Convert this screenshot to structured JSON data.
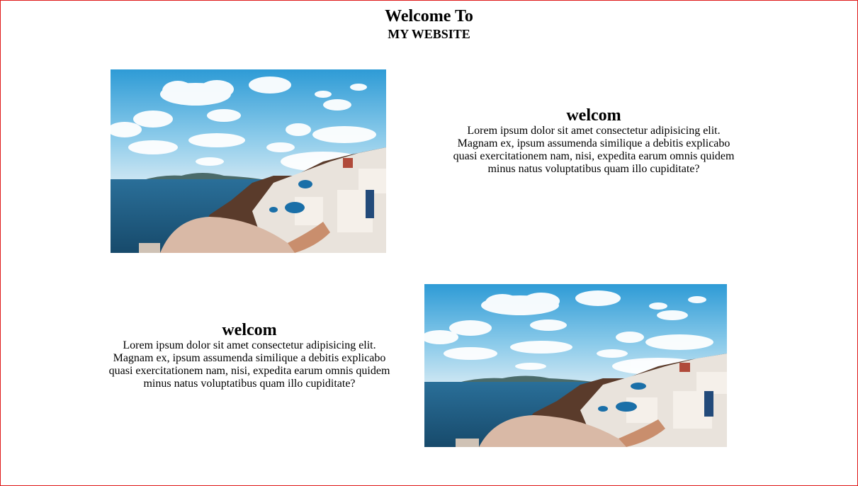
{
  "header": {
    "title": "Welcome To",
    "subtitle": "MY WEBSITE"
  },
  "sections": [
    {
      "heading": "welcom",
      "body": "Lorem ipsum dolor sit amet consectetur adipisicing elit. Magnam ex, ipsum assumenda similique a debitis explicabo quasi exercitationem nam, nisi, expedita earum omnis quidem minus natus voluptatibus quam illo cupiditate?",
      "image": "santorini-coast-photo"
    },
    {
      "heading": "welcom",
      "body": "Lorem ipsum dolor sit amet consectetur adipisicing elit. Magnam ex, ipsum assumenda similique a debitis explicabo quasi exercitationem nam, nisi, expedita earum omnis quidem minus natus voluptatibus quam illo cupiditate?",
      "image": "santorini-coast-photo"
    }
  ],
  "colors": {
    "page_border": "#e01b1b",
    "sky": "#3aa0d6",
    "sea": "#1f5f86"
  }
}
